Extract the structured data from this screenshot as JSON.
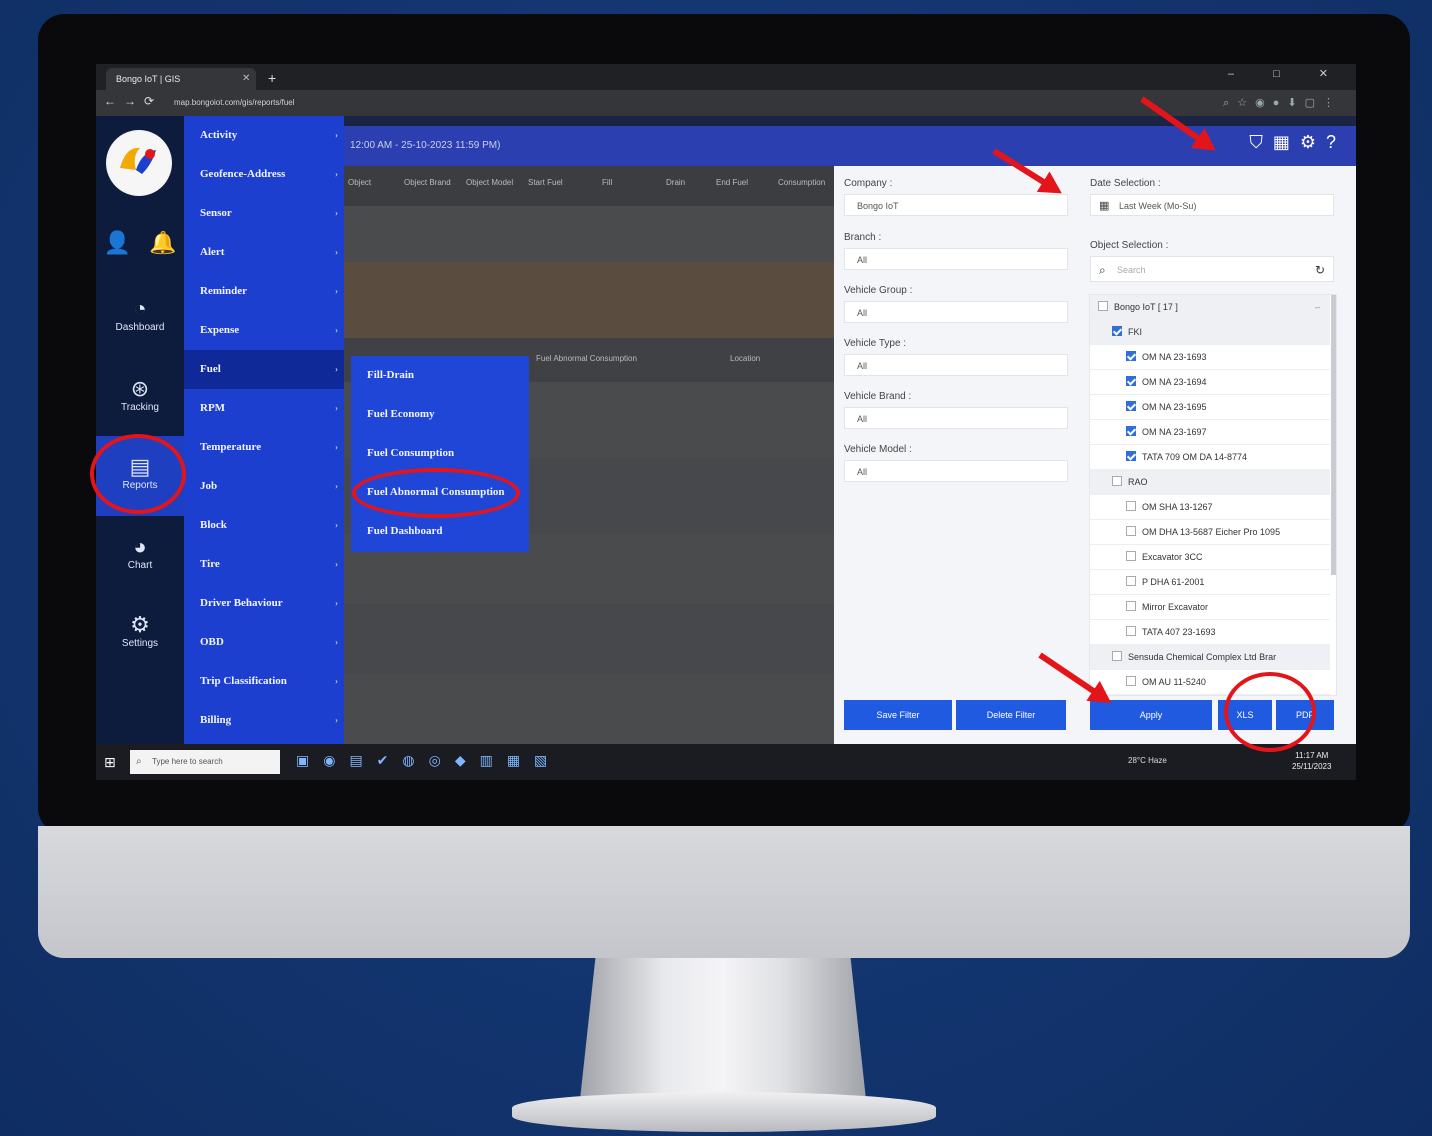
{
  "browser": {
    "tab_title": "Bongo IoT | GIS",
    "url": "map.bongoiot.com/gis/reports/fuel",
    "window_buttons": "– □ ✕"
  },
  "rail": {
    "items": [
      {
        "label": "Dashboard",
        "icon": "speedometer-icon"
      },
      {
        "label": "Tracking",
        "icon": "tracking-icon"
      },
      {
        "label": "Reports",
        "icon": "reports-icon"
      },
      {
        "label": "Chart",
        "icon": "chart-icon"
      },
      {
        "label": "Settings",
        "icon": "settings-icon"
      }
    ]
  },
  "menu1": {
    "items": [
      "Activity",
      "Geofence-Address",
      "Sensor",
      "Alert",
      "Reminder",
      "Expense",
      "Fuel",
      "RPM",
      "Temperature",
      "Job",
      "Block",
      "Tire",
      "Driver Behaviour",
      "OBD",
      "Trip Classification",
      "Billing"
    ],
    "active": "Fuel"
  },
  "menu2": {
    "items": [
      "Fill-Drain",
      "Fuel Economy",
      "Fuel Consumption",
      "Fuel Abnormal Consumption",
      "Fuel Dashboard"
    ]
  },
  "main": {
    "date_range": "12:00 AM - 25-10-2023 11:59 PM)",
    "table_headers": [
      "Object",
      "Object Brand",
      "Object Model",
      "Start Fuel",
      "Fill",
      "Drain",
      "End Fuel",
      "Consumption"
    ],
    "section_headers": [
      "Fuel Abnormal Consumption",
      "Location"
    ]
  },
  "filter": {
    "company_label": "Company :",
    "company_value": "Bongo IoT",
    "branch_label": "Branch :",
    "branch_value": "All",
    "vehicle_group_label": "Vehicle Group :",
    "vehicle_group_value": "All",
    "vehicle_type_label": "Vehicle Type :",
    "vehicle_type_value": "All",
    "vehicle_brand_label": "Vehicle Brand :",
    "vehicle_brand_value": "All",
    "vehicle_model_label": "Vehicle Model :",
    "vehicle_model_value": "All",
    "date_label": "Date Selection :",
    "date_value": "Last Week (Mo-Su)",
    "object_label": "Object Selection :",
    "search_placeholder": "Search",
    "tree": [
      {
        "label": "Bongo IoT [ 17 ]",
        "checked": false,
        "level": 0
      },
      {
        "label": "FKI",
        "checked": true,
        "level": 1
      },
      {
        "label": "OM NA 23-1693",
        "checked": true,
        "level": 2
      },
      {
        "label": "OM NA 23-1694",
        "checked": true,
        "level": 2
      },
      {
        "label": "OM NA 23-1695",
        "checked": true,
        "level": 2
      },
      {
        "label": "OM NA 23-1697",
        "checked": true,
        "level": 2
      },
      {
        "label": "TATA 709 OM DA 14-8774",
        "checked": true,
        "level": 2
      },
      {
        "label": "RAO",
        "checked": false,
        "level": 1
      },
      {
        "label": "OM SHA 13-1267",
        "checked": false,
        "level": 2
      },
      {
        "label": "OM DHA 13-5687 Eicher Pro 1095",
        "checked": false,
        "level": 2
      },
      {
        "label": "Excavator 3CC",
        "checked": false,
        "level": 2
      },
      {
        "label": "P DHA 61-2001",
        "checked": false,
        "level": 2
      },
      {
        "label": "Mirror Excavator",
        "checked": false,
        "level": 2
      },
      {
        "label": "TATA 407 23-1693",
        "checked": false,
        "level": 2
      },
      {
        "label": "Sensuda Chemical Complex Ltd Brar",
        "checked": false,
        "level": 1
      },
      {
        "label": "OM AU 11-5240",
        "checked": false,
        "level": 2
      }
    ],
    "buttons": {
      "save": "Save Filter",
      "delete": "Delete Filter",
      "apply": "Apply",
      "xls": "XLS",
      "pdf": "PDF"
    }
  },
  "taskbar": {
    "search_placeholder": "Type here to search",
    "weather": "28°C Haze",
    "time": "11:17 AM",
    "date": "25/11/2023"
  },
  "colors": {
    "accent": "#1d3fd0",
    "annotation": "#e3151b",
    "background": "#12346e"
  }
}
